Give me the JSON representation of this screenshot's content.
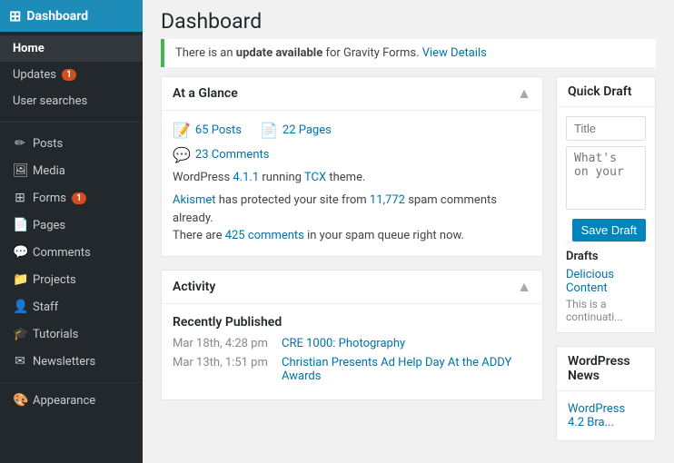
{
  "sidebar": {
    "header": {
      "label": "Dashboard",
      "icon": "⊞"
    },
    "items": [
      {
        "id": "home",
        "label": "Home",
        "icon": "",
        "active": true,
        "badge": null
      },
      {
        "id": "updates",
        "label": "Updates",
        "icon": "",
        "active": false,
        "badge": "1"
      },
      {
        "id": "user-searches",
        "label": "User searches",
        "icon": "",
        "active": false,
        "badge": null
      },
      {
        "id": "posts",
        "label": "Posts",
        "icon": "✏",
        "active": false,
        "badge": null
      },
      {
        "id": "media",
        "label": "Media",
        "icon": "🖼",
        "active": false,
        "badge": null
      },
      {
        "id": "forms",
        "label": "Forms",
        "icon": "⊞",
        "active": false,
        "badge": "1"
      },
      {
        "id": "pages",
        "label": "Pages",
        "icon": "📄",
        "active": false,
        "badge": null
      },
      {
        "id": "comments",
        "label": "Comments",
        "icon": "💬",
        "active": false,
        "badge": null
      },
      {
        "id": "projects",
        "label": "Projects",
        "icon": "📁",
        "active": false,
        "badge": null
      },
      {
        "id": "staff",
        "label": "Staff",
        "icon": "👤",
        "active": false,
        "badge": null
      },
      {
        "id": "tutorials",
        "label": "Tutorials",
        "icon": "🎓",
        "active": false,
        "badge": null
      },
      {
        "id": "newsletters",
        "label": "Newsletters",
        "icon": "✉",
        "active": false,
        "badge": null
      },
      {
        "id": "appearance",
        "label": "Appearance",
        "icon": "🎨",
        "active": false,
        "badge": null
      }
    ]
  },
  "page": {
    "title": "Dashboard"
  },
  "notice": {
    "text": "There is an update available for Gravity Forms.",
    "update_text": "There is an ",
    "update_bold": "update available",
    "update_rest": " for Gravity Forms.",
    "link_label": "View Details",
    "link_href": "#"
  },
  "at_a_glance": {
    "title": "At a Glance",
    "posts_count": "65 Posts",
    "pages_count": "22 Pages",
    "comments_count": "23 Comments",
    "wp_info": "WordPress 4.1.1 running TCX theme.",
    "wp_version": "4.1.1",
    "theme": "TCX",
    "akismet_text": "Akismet has protected your site from 11,772 spam comments already.",
    "spam_queue_text": "There are 425 comments in your spam queue right now.",
    "akismet_link": "Akismet",
    "spam_count": "11,772",
    "queue_count": "425"
  },
  "activity": {
    "title": "Activity",
    "recently_published": "Recently Published",
    "items": [
      {
        "date": "Mar 18th, 4:28 pm",
        "title": "CRE 1000: Photography",
        "href": "#"
      },
      {
        "date": "Mar 13th, 1:51 pm",
        "title": "Christian Presents Ad Help Day At the ADDY Awards",
        "href": "#"
      }
    ]
  },
  "quick_draft": {
    "title": "Quick Draft",
    "title_placeholder": "Title",
    "content_placeholder": "What's on your",
    "save_label": "Save Draft"
  },
  "drafts": {
    "title": "Drafts",
    "items": [
      {
        "title": "Delicious Content",
        "excerpt": "This is a continuati..."
      }
    ]
  },
  "wp_news": {
    "title": "WordPress News",
    "link_text": "WordPress 4.2 Bra..."
  }
}
